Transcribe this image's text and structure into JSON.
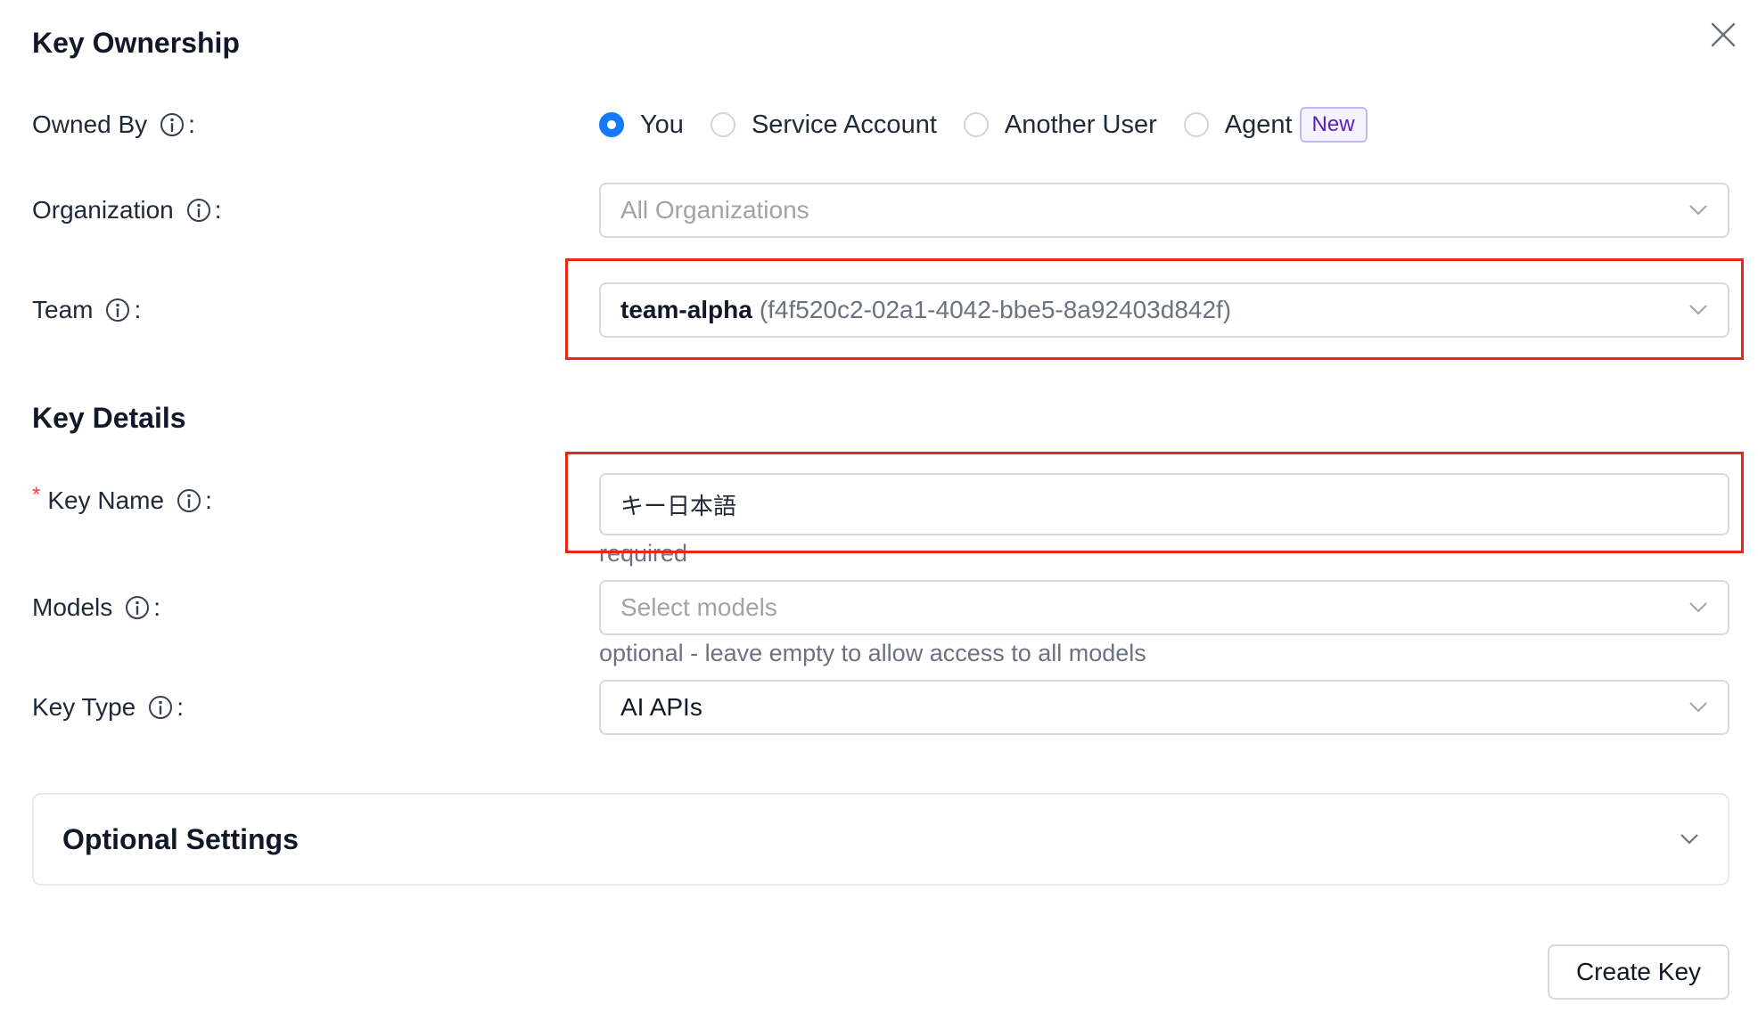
{
  "ownership": {
    "title": "Key Ownership",
    "owned_by_label": "Owned By",
    "owned_by_options": [
      "You",
      "Service Account",
      "Another User",
      "Agent"
    ],
    "owned_by_selected": "You",
    "agent_badge": "New",
    "organization_label": "Organization",
    "organization_placeholder": "All Organizations",
    "team_label": "Team",
    "team_name": "team-alpha",
    "team_id": "(f4f520c2-02a1-4042-bbe5-8a92403d842f)"
  },
  "details": {
    "title": "Key Details",
    "required_mark": "*",
    "key_name_label": "Key Name",
    "key_name_value": "キー日本語",
    "key_name_hint": "required",
    "models_label": "Models",
    "models_placeholder": "Select models",
    "models_hint": "optional - leave empty to allow access to all models",
    "key_type_label": "Key Type",
    "key_type_value": "AI APIs"
  },
  "optional_settings": {
    "title": "Optional Settings"
  },
  "actions": {
    "create_label": "Create Key"
  },
  "colon": ":",
  "colors": {
    "accent": "#1677ff",
    "highlight": "#e8271b",
    "badge": "#5b21b6"
  }
}
